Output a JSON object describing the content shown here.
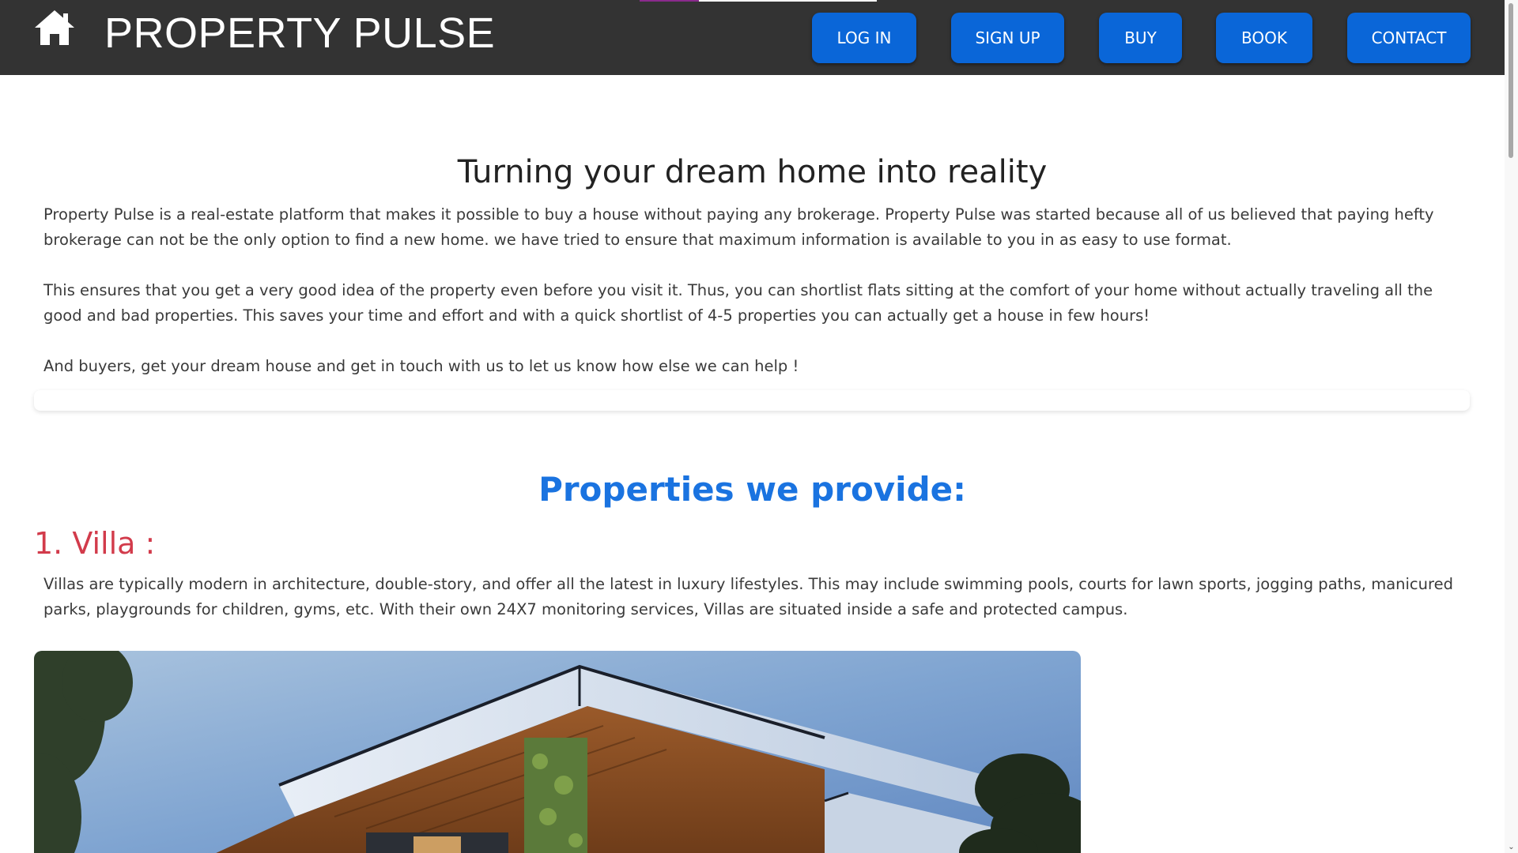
{
  "header": {
    "brand": "PROPERTY PULSE",
    "home_icon": "home-icon",
    "scroll_progress": 0.25,
    "nav": {
      "login": "LOG IN",
      "signup": "SIGN UP",
      "buy": "BUY",
      "book": "BOOK",
      "contact": "CONTACT"
    }
  },
  "about": {
    "title": "Turning your dream home into reality",
    "paragraph1": "Property Pulse is a real-estate platform that makes it possible to buy a house without paying any brokerage. Property Pulse was started because all of us believed that paying hefty brokerage can not be the only option to find a new home. we have tried to ensure that maximum information is available to you in as easy to use format.",
    "paragraph2": "This ensures that you get a very good idea of the property even before you visit it. Thus, you can shortlist flats sitting at the comfort of your home without actually traveling all the good and bad properties. This saves your time and effort and with a quick shortlist of 4-5 properties you can actually get a house in few hours!",
    "paragraph3": "And buyers, get your dream house and get in touch with us to let us know how else we can help !"
  },
  "properties": {
    "title": "Properties we provide:",
    "villa": {
      "title": "1. Villa :",
      "description": "Villas are typically modern in architecture, double-story, and offer all the latest in luxury lifestyles. This may include swimming pools, courts for lawn sports, jogging paths, manicured parks, playgrounds for children, gyms, etc. With their own 24X7 monitoring services, Villas are situated inside a safe and protected campus."
    }
  },
  "colors": {
    "navbar": "#333333",
    "button": "#0a66d8",
    "section_title": "#1a73e0",
    "villa_title": "#d23b4b",
    "progress": "#8a2a8c"
  }
}
